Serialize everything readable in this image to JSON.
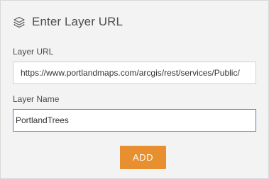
{
  "dialog": {
    "title": "Enter Layer URL",
    "header_icon": "layers-icon"
  },
  "layer_url": {
    "label": "Layer URL",
    "value": "https://www.portlandmaps.com/arcgis/rest/services/Public/"
  },
  "layer_name": {
    "label": "Layer Name",
    "value": "PortlandTrees"
  },
  "actions": {
    "add_label": "ADD"
  },
  "colors": {
    "panel_background": "#f3f3f3",
    "button_accent": "#e88f30",
    "focused_input_border": "#5b7fa3"
  }
}
